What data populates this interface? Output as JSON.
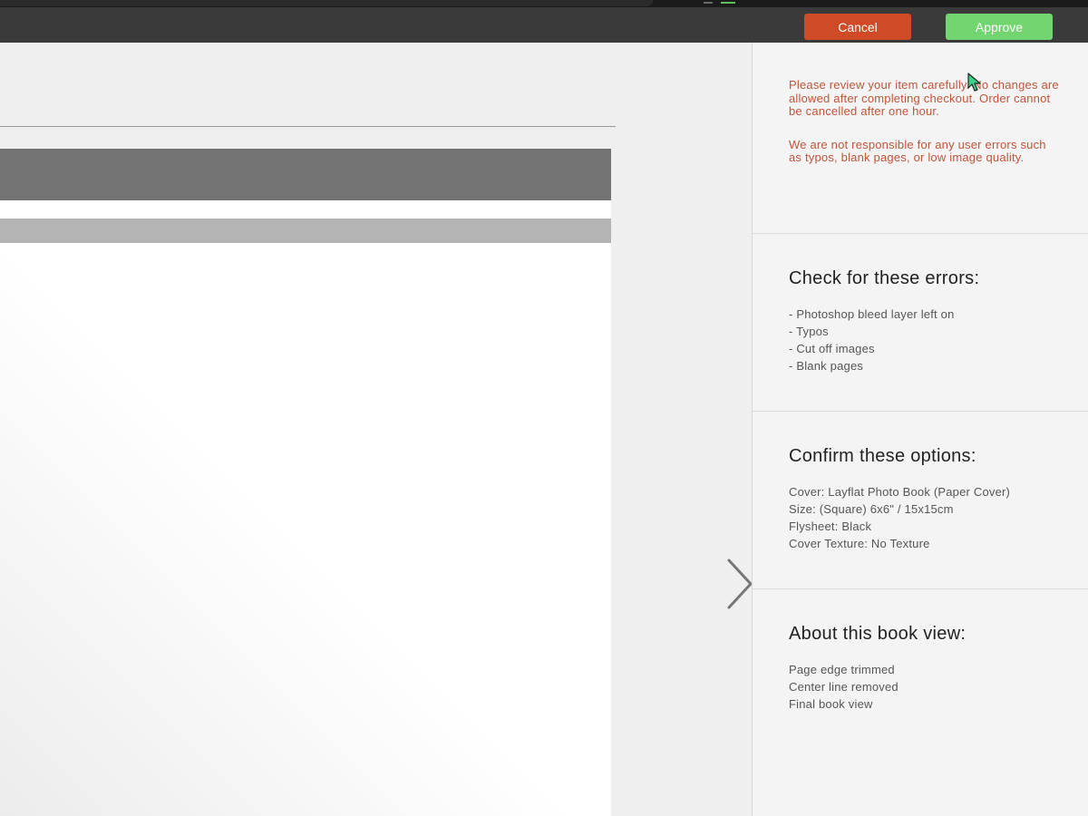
{
  "toolbar": {
    "cancel_label": "Cancel",
    "approve_label": "Approve"
  },
  "notices": {
    "review": "Please review your item carefully. No changes are allowed after completing checkout. Order cannot be cancelled after one hour.",
    "responsibility": "We are not responsible for any user errors such as typos, blank pages, or low image quality."
  },
  "errors_section": {
    "title": "Check for these errors:",
    "items": [
      "- Photoshop bleed layer left on",
      "- Typos",
      "- Cut off images",
      "- Blank pages"
    ]
  },
  "options_section": {
    "title": "Confirm these options:",
    "items": [
      "Cover: Layflat Photo Book (Paper Cover)",
      "Size: (Square) 6x6\" / 15x15cm",
      "Flysheet: Black",
      "Cover Texture: No Texture"
    ]
  },
  "about_section": {
    "title": "About this book view:",
    "items": [
      "Page edge trimmed",
      "Center line removed",
      "Final book view"
    ]
  },
  "colors": {
    "cancel": "#cf4a26",
    "approve": "#72d56f",
    "warning_text": "#c0553a",
    "toolbar": "#3a3a3a"
  },
  "icons": {
    "next": "chevron-right-icon",
    "cursor": "mouse-pointer-icon"
  }
}
